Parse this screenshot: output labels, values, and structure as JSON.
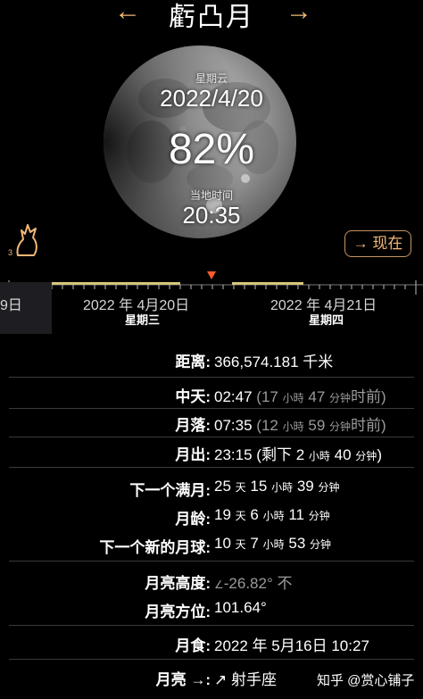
{
  "header": {
    "title": "虧凸月",
    "prev_icon": "left-arrow-icon",
    "next_icon": "right-arrow-icon"
  },
  "moon": {
    "weekday": "星期云",
    "date": "2022/4/20",
    "illumination": "82%",
    "illumination_fraction": 0.82,
    "local_time_label": "当地时间",
    "local_time": "20:35"
  },
  "wolf": {
    "icon": "wolf-howl-icon",
    "count": "3"
  },
  "now_button": {
    "label": "→ 现在"
  },
  "timeline": {
    "left_cut_label": "9日",
    "dates": [
      {
        "label": "2022 年 4月20日",
        "weekday": "星期三"
      },
      {
        "label": "2022 年 4月21日",
        "weekday": "星期四"
      }
    ]
  },
  "rows": {
    "distance": {
      "label": "距离:",
      "value": "366,574.181 千米"
    },
    "culmination": {
      "label": "中天:",
      "time": "02:47",
      "paren_open": "(",
      "n1": "17",
      "u1": "小時",
      "n2": "47",
      "u2": "分钟",
      "suffix": "时前)"
    },
    "moonset": {
      "label": "月落:",
      "time": "07:35",
      "paren_open": "(",
      "n1": "12",
      "u1": "小時",
      "n2": "59",
      "u2": "分钟",
      "suffix": "时前)"
    },
    "moonrise": {
      "label": "月出:",
      "time": "23:15",
      "prefix": "(剩下",
      "n1": "2",
      "u1": "小時",
      "n2": "40",
      "u2": "分钟",
      "suffix": ")"
    },
    "next_full": {
      "label": "下一个满月:",
      "n1": "25",
      "u1": "天",
      "n2": "15",
      "u2": "小時",
      "n3": "39",
      "u3": "分钟"
    },
    "age": {
      "label": "月龄:",
      "n1": "19",
      "u1": "天",
      "n2": "6",
      "u2": "小時",
      "n3": "11",
      "u3": "分钟"
    },
    "next_new": {
      "label": "下一个新的月球:",
      "n1": "10",
      "u1": "天",
      "n2": "7",
      "u2": "小時",
      "n3": "53",
      "u3": "分钟"
    },
    "altitude": {
      "label": "月亮高度:",
      "icon": "angle-icon",
      "value": "-26.82°",
      "note": "不"
    },
    "azimuth": {
      "label": "月亮方位:",
      "value": "101.64°"
    },
    "eclipse": {
      "label": "月食:",
      "value": "2022 年 5月16日 10:27"
    },
    "zodiac": {
      "label": "月亮 →:",
      "icon": "sagittarius-icon",
      "value": "射手座"
    }
  },
  "watermark": "知乎 @赏心铺子"
}
